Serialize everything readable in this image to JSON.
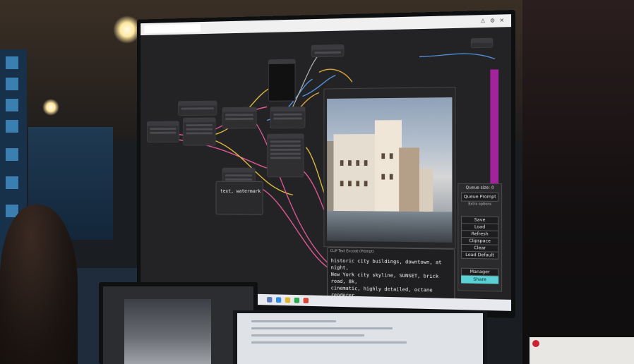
{
  "app": {
    "name": "ComfyUI-like node editor (photo of monitor)"
  },
  "prompt_node": {
    "title": "CLIP Text Encode (Prompt)",
    "text": "historic city buildings, downtown, at night,\nNew York city skyline, SUNSET, brick road, 8k,\ncinematic, highly detailed, octane renderer,\ntrending on artstation, vibrant,"
  },
  "negative_prompt_node": {
    "text": "text, watermark"
  },
  "side_menu": {
    "queue_size": "Queue size: 0",
    "queue_prompt": "Queue Prompt",
    "extra_options": "Extra options",
    "buttons": [
      "Save",
      "Load",
      "Refresh",
      "Clipspace",
      "Clear",
      "Load Default"
    ],
    "manager": "Manager",
    "share": "Share"
  },
  "colors": {
    "accent_magenta": "#a3239a",
    "share_button": "#5ad1d4",
    "canvas_bg": "#232325"
  },
  "icons": [
    "close-icon",
    "settings-icon",
    "warning-icon"
  ]
}
